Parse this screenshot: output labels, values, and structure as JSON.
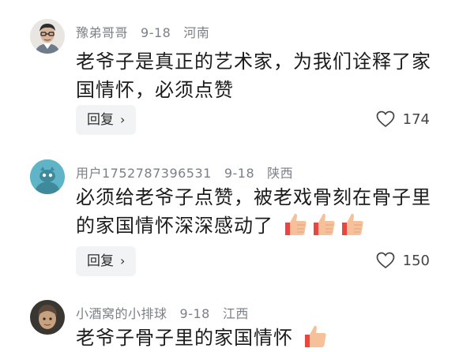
{
  "comments": [
    {
      "username": "豫弟哥哥",
      "date": "9-18",
      "location": "河南",
      "text": "老爷子是真正的艺术家，为我们诠释了家国情怀，必须点赞",
      "reply_label": "回复",
      "likes": "174",
      "avatar_icon": "man-with-glasses-avatar"
    },
    {
      "username": "用户1752787396531",
      "date": "9-18",
      "location": "陕西",
      "text": "必须给老爷子点赞，被老戏骨刻在骨子里的家国情怀深深感动了",
      "reply_label": "回复",
      "likes": "150",
      "avatar_icon": "teal-default-avatar",
      "emoji_count": 3,
      "emoji_icon": "thumbs-up-icon"
    },
    {
      "username": "小酒窝的小排球",
      "date": "9-18",
      "location": "江西",
      "text": "老爷子骨子里的家国情怀",
      "avatar_icon": "helmet-figure-avatar",
      "emoji_icon": "thumbs-up-icon"
    }
  ],
  "colors": {
    "meta": "#7b7f86",
    "reply_bg": "#f2f3f5",
    "avatar_teal": "#5fb5c7"
  }
}
